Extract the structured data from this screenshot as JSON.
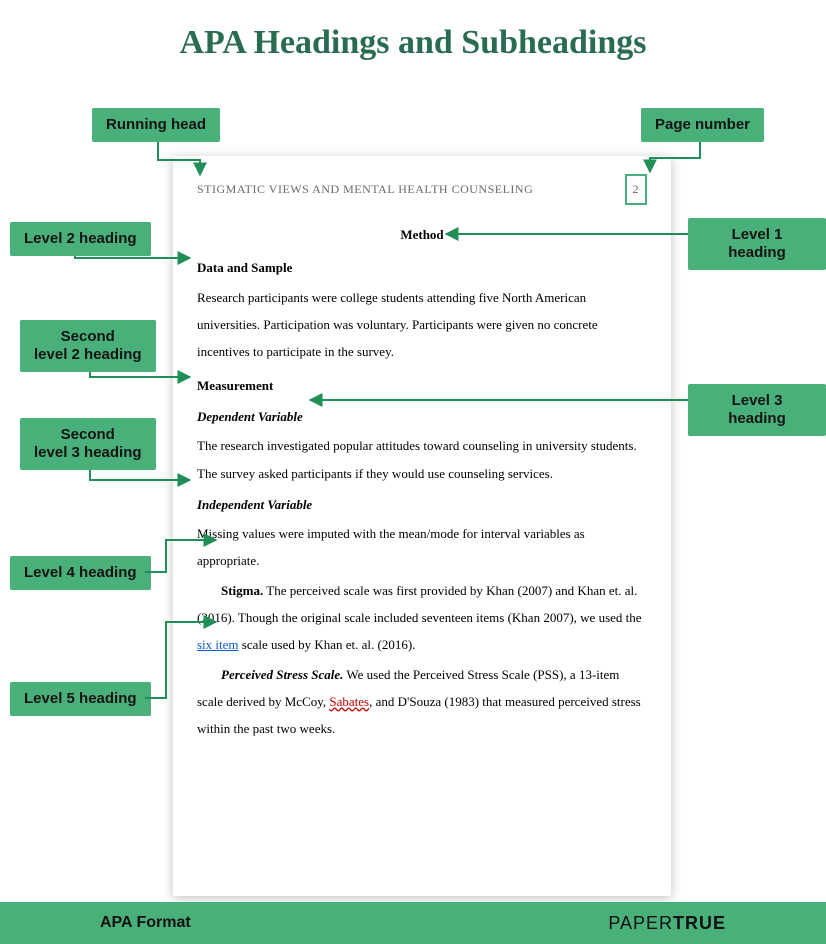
{
  "title": "APA Headings and Subheadings",
  "tags": {
    "running_head": "Running head",
    "page_number": "Page number",
    "level1": "Level 1 heading",
    "level2": "Level 2 heading",
    "second_l2": "Second\nlevel 2 heading",
    "level3": "Level 3 heading",
    "second_l3": "Second\nlevel 3 heading",
    "level4": "Level 4 heading",
    "level5": "Level 5 heading"
  },
  "paper": {
    "running_head": "STIGMATIC VIEWS AND MENTAL HEALTH COUNSELING",
    "page_number": "2",
    "l1": "Method",
    "l2a": "Data and Sample",
    "p1": "Research participants were college students attending five North American universities. Participation was voluntary. Participants were given no concrete incentives to participate in the survey.",
    "l2b": "Measurement",
    "l3a": "Dependent Variable",
    "p2": "The research investigated popular attitudes toward counseling in university students. The survey asked participants if they would use counseling services.",
    "l3b": "Independent Variable",
    "p3": "Missing values were imputed with the mean/mode for interval variables as appropriate.",
    "l4_label": "Stigma.",
    "p4a": " The perceived scale was first provided by Khan (2007) and Khan et. al. (2016). Though the original scale included seventeen items (Khan 2007), we used the ",
    "p4_link": "six item",
    "p4b": " scale used by Khan et. al. (2016).",
    "l5_label": "Perceived Stress Scale.",
    "p5a": " We used the Perceived Stress Scale (PSS), a 13-item scale derived by McCoy, ",
    "p5_red": "Sabates",
    "p5b": ", and D'Souza (1983) that measured perceived stress within the past two weeks."
  },
  "footer": {
    "left": "APA Format",
    "brand_thin": "PAPER",
    "brand_bold": "TRUE"
  }
}
